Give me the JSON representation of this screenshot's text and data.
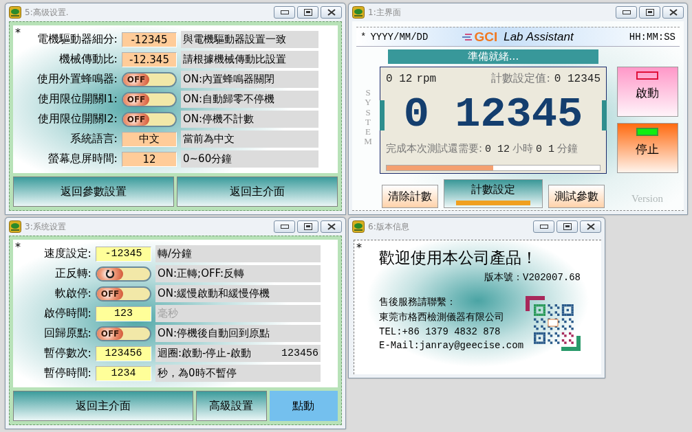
{
  "advanced_settings": {
    "title": "5:高级设置.",
    "marker": "*",
    "rows": [
      {
        "kind": "field",
        "label": "電機驅動器細分:",
        "value": "-12345",
        "note": "與電機驅動器設置一致"
      },
      {
        "kind": "field",
        "label": "機械傳動比:",
        "value": "-12.345",
        "note": "請根據機械傳動比設置"
      },
      {
        "kind": "toggle",
        "label": "使用外置蜂鳴器:",
        "on": false,
        "toggle_text": "OFF",
        "note": "ON:內置蜂鳴器關閉"
      },
      {
        "kind": "toggle",
        "label": "使用限位開關I1:",
        "on": false,
        "toggle_text": "OFF",
        "note": "ON:自動歸零不停機"
      },
      {
        "kind": "toggle",
        "label": "使用限位開關I2:",
        "on": false,
        "toggle_text": "OFF",
        "note": "ON:停機不計數"
      },
      {
        "kind": "field",
        "label": "系統語言:",
        "value": "中文",
        "note": "當前為中文"
      },
      {
        "kind": "field",
        "label": "螢幕息屏時間:",
        "value": "12",
        "note": "0~60分鐘"
      }
    ],
    "buttons": [
      {
        "label": "返回參數設置",
        "selected": false
      },
      {
        "label": "返回主介面",
        "selected": false
      }
    ]
  },
  "main": {
    "title": "1:主界面",
    "marker": "*",
    "date": "YYYY/MM/DD",
    "logo": "GCI",
    "app_name": "Lab Assistant",
    "time": "HH:MM:SS",
    "side_label": "SYSTEM",
    "status": "準備就緒...",
    "speed": "0 12",
    "speed_unit": "rpm",
    "count_label": "計數設定值:",
    "count_setting": "0 12345",
    "count": "0 12345",
    "remaining_label": "完成本次測試還需要:",
    "hours": "0 12",
    "hours_unit": "小時",
    "minutes": "0 1",
    "minutes_unit": "分鐘",
    "progress": {
      "level": 0.5
    },
    "buttons": [
      {
        "label": "清除計數",
        "selected": false
      },
      {
        "label": "計數設定",
        "selected": true
      },
      {
        "label": "測試參數",
        "selected": false
      }
    ],
    "controls": [
      {
        "kind": "start",
        "label": "啟動",
        "lamp_on": false
      },
      {
        "kind": "stop",
        "label": "停止",
        "lamp_on": true
      }
    ],
    "version_label": "Version"
  },
  "system_settings": {
    "title": "3:系统设置",
    "marker": "*",
    "rows": [
      {
        "kind": "field",
        "label": "速度設定:",
        "value": "-12345",
        "note": "轉/分鐘",
        "note_disabled": false
      },
      {
        "kind": "direction_toggle",
        "label": "正反轉:",
        "on": false,
        "note": "ON:正轉;OFF:反轉",
        "note_disabled": false
      },
      {
        "kind": "toggle",
        "label": "軟啟停:",
        "on": false,
        "toggle_text": "OFF",
        "note": "ON:緩慢啟動和緩慢停機",
        "note_disabled": false
      },
      {
        "kind": "field",
        "label": "啟停時間:",
        "value": "123",
        "note": "毫秒",
        "note_disabled": true
      },
      {
        "kind": "toggle",
        "label": "回歸原點:",
        "on": false,
        "toggle_text": "OFF",
        "note": "ON:停機後自動回到原點",
        "note_disabled": false
      },
      {
        "kind": "field",
        "label": "暫停數次:",
        "value": "123456",
        "note": "迴圈:啟動-停止-啟動",
        "note_value": "123456",
        "note_disabled": false
      },
      {
        "kind": "field",
        "label": "暫停時間:",
        "value": "1234",
        "note": "秒，為0時不暫停",
        "note_disabled": false
      }
    ],
    "buttons": [
      {
        "label": "返回主介面",
        "selected": false
      },
      {
        "label": "高級設置",
        "selected": false
      },
      {
        "label": "點動",
        "selected": true
      }
    ]
  },
  "version_info": {
    "title": "6:版本信息",
    "marker": "*",
    "welcome": "歡迎使用本公司產品！",
    "version": "版本號：V202007.68",
    "contact_label": "售後服務請聯繫：",
    "company": "東莞市格西檢測儀器有限公司",
    "tel": "TEL:+86 1379 4832 878",
    "email": "E-Mail:janray@geecise.com"
  }
}
